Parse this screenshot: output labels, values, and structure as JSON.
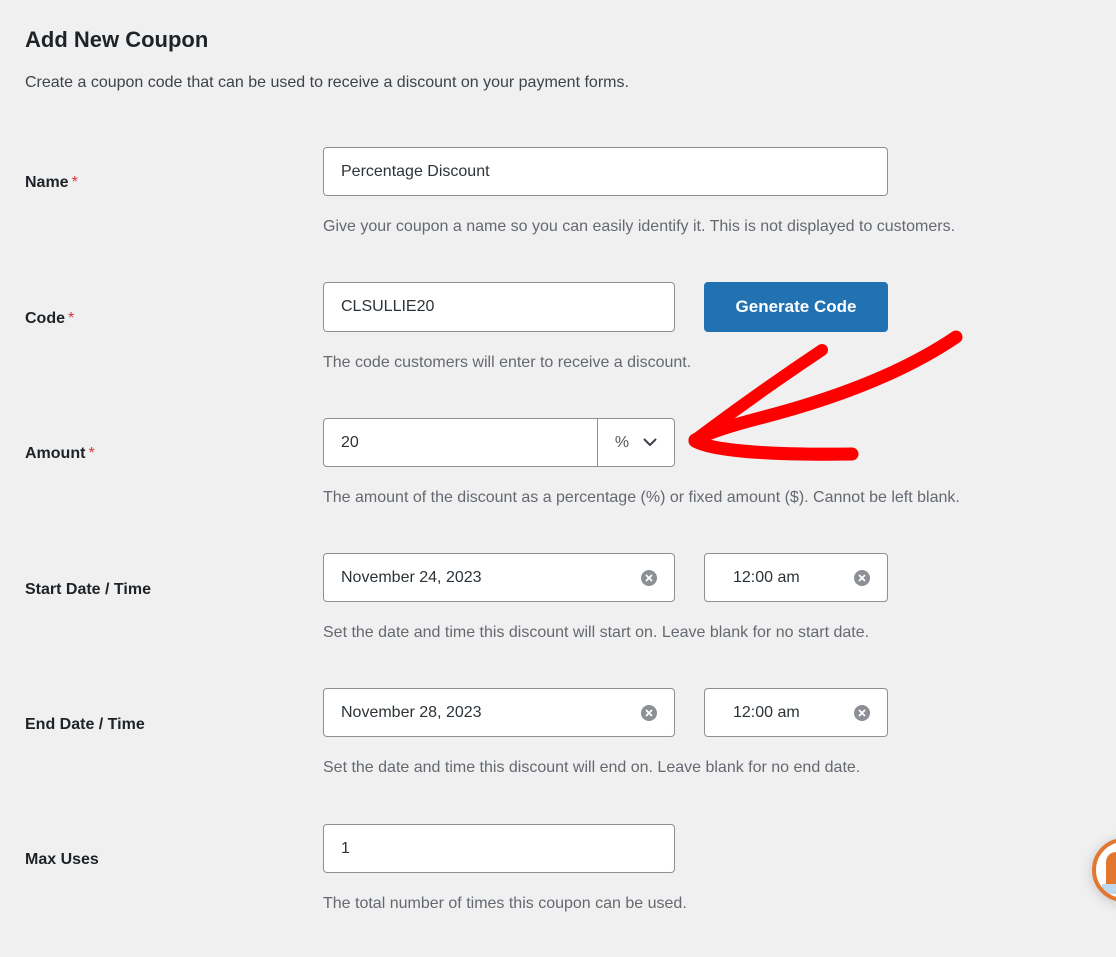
{
  "page": {
    "title": "Add New Coupon",
    "description": "Create a coupon code that can be used to receive a discount on your payment forms."
  },
  "required_marker": "*",
  "colors": {
    "background": "#f0f0f1",
    "primary_button": "#2271b1",
    "required": "#d63638",
    "annotation_arrow": "#ff0000",
    "mascot_accent": "#e27730"
  },
  "fields": {
    "name": {
      "label": "Name",
      "required": true,
      "value": "Percentage Discount",
      "help": "Give your coupon a name so you can easily identify it. This is not displayed to customers."
    },
    "code": {
      "label": "Code",
      "required": true,
      "value": "CLSULLIE20",
      "button_label": "Generate Code",
      "help": "The code customers will enter to receive a discount."
    },
    "amount": {
      "label": "Amount",
      "required": true,
      "value": "20",
      "unit_selected": "%",
      "unit_icon": "chevron-down-icon",
      "help": "The amount of the discount as a percentage (%) or fixed amount ($). Cannot be left blank."
    },
    "start": {
      "label": "Start Date / Time",
      "date_value": "November 24, 2023",
      "time_value": "12:00 am",
      "clear_icon": "clear-circle-icon",
      "help": "Set the date and time this discount will start on. Leave blank for no start date."
    },
    "end": {
      "label": "End Date / Time",
      "date_value": "November 28, 2023",
      "time_value": "12:00 am",
      "clear_icon": "clear-circle-icon",
      "help": "Set the date and time this discount will end on. Leave blank for no end date."
    },
    "max_uses": {
      "label": "Max Uses",
      "value": "1",
      "help": "The total number of times this coupon can be used."
    }
  },
  "annotation": {
    "type": "hand-drawn-arrow",
    "points_to": "amount-unit-select"
  },
  "mascot": {
    "icon": "mascot-badge-icon"
  }
}
